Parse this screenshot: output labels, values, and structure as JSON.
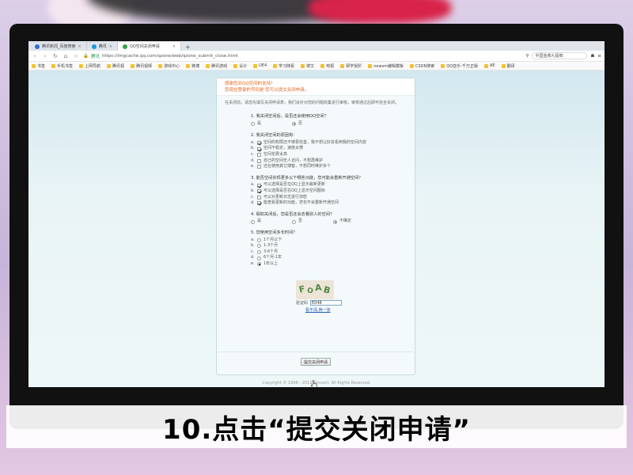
{
  "browser": {
    "tabs": [
      {
        "label": "腾讯新闻_百度搜索"
      },
      {
        "label": "腾讯"
      },
      {
        "label": "QQ空间关闭申请"
      }
    ],
    "url_site": "腾讯",
    "url": "https://imgcache.qq.com/qzone/web/qzone_submit_close.html",
    "search_text": "中国金牌九极牌",
    "bookmarks": [
      "书签",
      "手机书签",
      "上网导航",
      "腾讯视",
      "腾讯视频",
      "游戏中心",
      "微博",
      "腾讯游戏",
      "设计",
      "UE4",
      "学习随看",
      "搜文",
      "电视",
      "即学受阶",
      "newsm编辑模板",
      "CSDN搜索",
      "QQ音乐-千万正版",
      "AE",
      "翻译"
    ]
  },
  "form": {
    "header_line1": "感谢您对QQ空间的支持！",
    "header_line2": "您现在登录的号码是              您可以提交关闭申请。",
    "intro": "在关闭前，请您先填写关闭申请表，我们会针对您的问题收集进行审核，审核通过后即可完全关闭。",
    "q1": {
      "title": "1. 我关闭空间后，是否还会使用QQ空间？",
      "options": [
        {
          "label": "是",
          "checked": false
        },
        {
          "label": "否",
          "checked": true
        }
      ]
    },
    "q2": {
      "title": "2. 我关闭空间的原因有：",
      "options": [
        {
          "letter": "a.",
          "label": "空间的权限还不够更完善，我不想让好友看到我的空间内容",
          "checked": true
        },
        {
          "letter": "b.",
          "label": "空间不稳定，速度太慢",
          "checked": true
        },
        {
          "letter": "c.",
          "label": "空间花费太高",
          "checked": false
        },
        {
          "letter": "d.",
          "label": "自己的空间无人访问，不想再维护",
          "checked": false
        },
        {
          "letter": "e.",
          "label": "还在使用其它博客，不想同时维护多个",
          "checked": false
        }
      ]
    },
    "q3": {
      "title": "3. 能否空间实现更多以下哪些功能，您可能会重新开通空间？",
      "options": [
        {
          "letter": "a.",
          "label": "可以选择是否在QQ上显示最新更新",
          "checked": true
        },
        {
          "letter": "b.",
          "label": "可以选择是否在QQ上显示空间图标",
          "checked": true
        },
        {
          "letter": "c.",
          "label": "可以对更新日志进行加密",
          "checked": false
        },
        {
          "letter": "d.",
          "label": "能查看更新的功能，您也不会重新开通空间",
          "checked": true
        }
      ]
    },
    "q4": {
      "title": "4. 假如关闭后，您是否还会去看别人的空间？",
      "options": [
        {
          "label": "是",
          "checked": false
        },
        {
          "label": "否",
          "checked": false
        },
        {
          "label": "不确定",
          "checked": true
        }
      ]
    },
    "q5": {
      "title": "5. 您使用空间多长时间？",
      "options": [
        {
          "letter": "a.",
          "label": "1个月以下",
          "checked": false
        },
        {
          "letter": "b.",
          "label": "1-3个月",
          "checked": false
        },
        {
          "letter": "c.",
          "label": "3-6个月",
          "checked": false
        },
        {
          "letter": "d.",
          "label": "6个月-1年",
          "checked": false
        },
        {
          "letter": "e.",
          "label": "1年以上",
          "checked": true
        }
      ]
    },
    "captcha_text": "FOAB",
    "captcha_label": "验证码",
    "captcha_value": "E048",
    "captcha_refresh": "看不清,换一张",
    "submit_label": "提交关闭申请",
    "copyright": "Copyright © 1998 - 2011 Tencent. All Rights Reserved."
  },
  "caption": "10.点击“提交关闭申请”"
}
